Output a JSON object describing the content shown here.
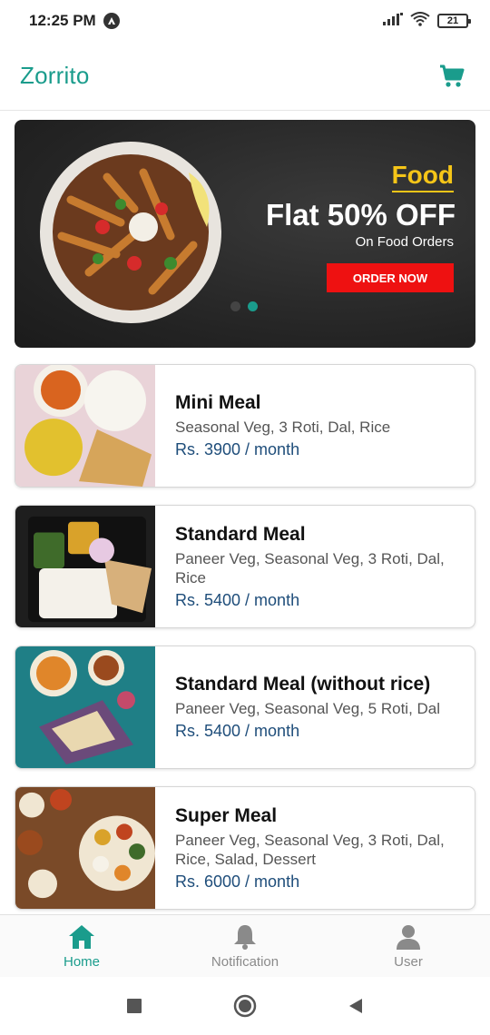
{
  "status_bar": {
    "time": "12:25 PM",
    "battery": "21",
    "icons": [
      "app-notification-icon",
      "signal-icon",
      "wifi-icon",
      "battery-icon"
    ]
  },
  "app_bar": {
    "title": "Zorrito",
    "cart_icon": "cart-icon"
  },
  "banner": {
    "category": "Food",
    "headline": "Flat 50% OFF",
    "subtext": "On Food Orders",
    "cta_label": "ORDER NOW",
    "slide_count": 2,
    "active_slide": 2
  },
  "meals": [
    {
      "name": "Mini Meal",
      "description": "Seasonal Veg, 3 Roti, Dal, Rice",
      "price": "Rs. 3900 / month"
    },
    {
      "name": "Standard Meal",
      "description": "Paneer Veg, Seasonal Veg, 3 Roti, Dal, Rice",
      "price": "Rs. 5400 / month"
    },
    {
      "name": "Standard Meal (without rice)",
      "description": "Paneer Veg, Seasonal Veg, 5 Roti, Dal",
      "price": "Rs. 5400 / month"
    },
    {
      "name": "Super Meal",
      "description": "Paneer Veg, Seasonal Veg, 3 Roti, Dal, Rice, Salad, Dessert",
      "price": "Rs. 6000 / month"
    }
  ],
  "bottom_nav": {
    "items": [
      {
        "label": "Home",
        "icon": "home-icon",
        "active": true
      },
      {
        "label": "Notification",
        "icon": "bell-icon",
        "active": false
      },
      {
        "label": "User",
        "icon": "user-icon",
        "active": false
      }
    ]
  },
  "colors": {
    "brand": "#1a9c8c",
    "banner_accent": "#f5c518",
    "cta": "#ee1111",
    "price": "#1e4d7a"
  }
}
